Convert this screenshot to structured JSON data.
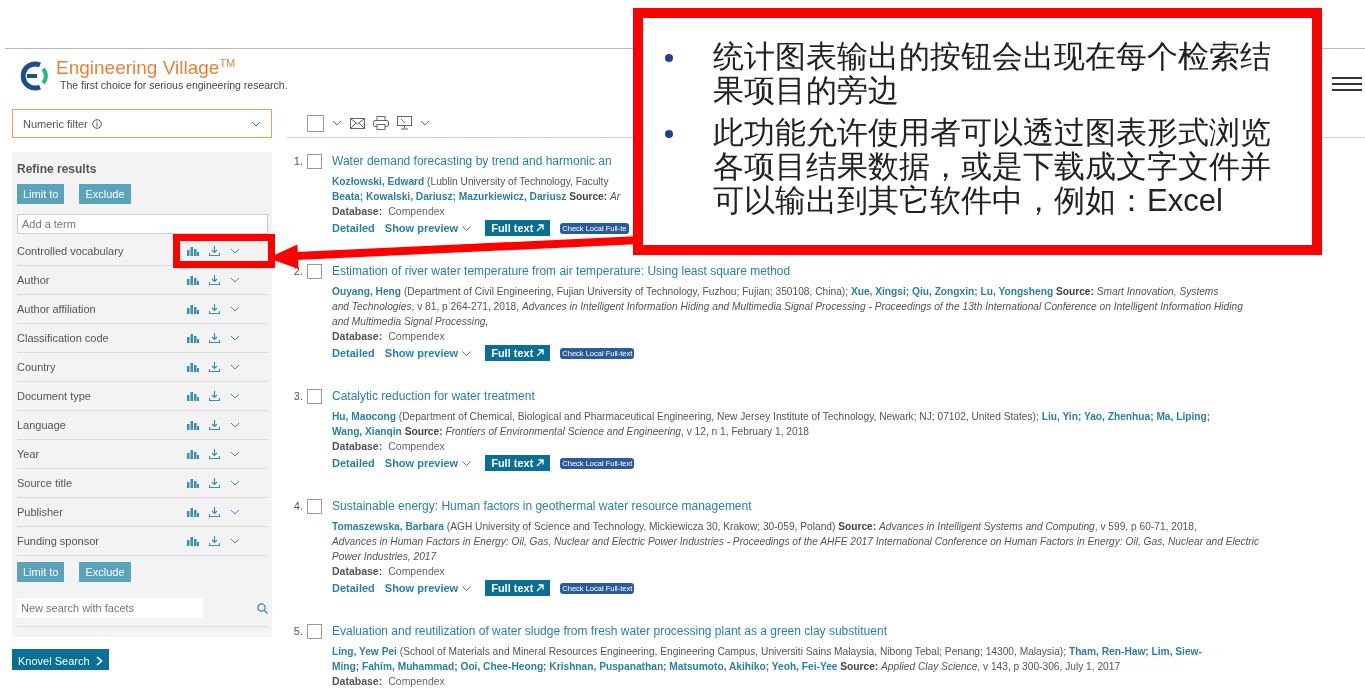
{
  "logo": {
    "name": "Engineering Village",
    "trademark": "TM",
    "tagline": "The first choice for serious engineering research."
  },
  "numeric_filter": {
    "label": "Numeric filter"
  },
  "refine": {
    "title": "Refine results",
    "top_buttons": [
      "Limit to",
      "Exclude"
    ],
    "term_placeholder": "Add a term",
    "facets": [
      {
        "label": "Controlled vocabulary",
        "highlighted": true
      },
      {
        "label": "Author",
        "highlighted": false
      },
      {
        "label": "Author affiliation",
        "highlighted": false
      },
      {
        "label": "Classification code",
        "highlighted": false
      },
      {
        "label": "Country",
        "highlighted": false
      },
      {
        "label": "Document type",
        "highlighted": false
      },
      {
        "label": "Language",
        "highlighted": false
      },
      {
        "label": "Year",
        "highlighted": false
      },
      {
        "label": "Source title",
        "highlighted": false
      },
      {
        "label": "Publisher",
        "highlighted": false
      },
      {
        "label": "Funding sponsor",
        "highlighted": false
      }
    ],
    "bottom_buttons": [
      "Limit to",
      "Exclude"
    ],
    "facet_search_placeholder": "New search with facets"
  },
  "knovel_button": "Knovel Search",
  "select_all": {
    "checked": false
  },
  "results": [
    {
      "number": "1.",
      "checked": false,
      "title": "Water demand forecasting by trend and harmonic an",
      "lines": [
        [
          {
            "kind": "author",
            "t": "Kozłowski, Edward"
          },
          {
            "kind": "plain",
            "t": " (Lublin University of Technology, Faculty"
          }
        ],
        [
          {
            "kind": "author",
            "t": "Beata; Kowalski, Dariusz; Mazurkiewicz, Dariusz"
          },
          {
            "kind": "label",
            "t": " Source: "
          },
          {
            "kind": "italic",
            "t": "Ar"
          }
        ]
      ],
      "database_label": "Database:",
      "database": "Compendex",
      "actions": {
        "detailed": "Detailed",
        "preview": "Show preview",
        "full_text": "Full text",
        "local": "Check Local Full-te"
      }
    },
    {
      "number": "2.",
      "checked": false,
      "title": "Estimation of river water temperature from air temperature: Using least square method",
      "lines": [
        [
          {
            "kind": "author",
            "t": "Ouyang, Heng"
          },
          {
            "kind": "plain",
            "t": " (Department of Civil Engineering, Fujian University of Technology, Fuzhou; Fujian; 350108, China); "
          },
          {
            "kind": "author",
            "t": "Xue, Xingsi; Qiu, Zongxin; Lu, Yongsheng"
          },
          {
            "kind": "label",
            "t": " Source: "
          },
          {
            "kind": "italic",
            "t": "Smart Innovation, Systems"
          }
        ],
        [
          {
            "kind": "italic",
            "t": "and Technologies"
          },
          {
            "kind": "plain",
            "t": ", v 81, p 264-271, 2018, "
          },
          {
            "kind": "italic",
            "t": "Advances in Intelligent Information Hiding and Multimedia Signal Processing - Proceedings of the 13th International Conference on Intelligent Information Hiding"
          }
        ],
        [
          {
            "kind": "italic",
            "t": "and Multimedia Signal Processing,"
          }
        ]
      ],
      "database_label": "Database:",
      "database": "Compendex",
      "actions": {
        "detailed": "Detailed",
        "preview": "Show preview",
        "full_text": "Full text",
        "local": "Check Local Full-text"
      }
    },
    {
      "number": "3.",
      "checked": false,
      "title": "Catalytic reduction for water treatment",
      "lines": [
        [
          {
            "kind": "author",
            "t": "Hu, Maocong"
          },
          {
            "kind": "plain",
            "t": " (Department of Chemical, Biological and Pharmaceutical Engineering, New Jersey Institute of Technology, Newark; NJ; 07102, United States); "
          },
          {
            "kind": "author",
            "t": "Liu, Yin; Yao, Zhenhua; Ma, Liping;"
          }
        ],
        [
          {
            "kind": "author",
            "t": "Wang, Xianqin"
          },
          {
            "kind": "label",
            "t": " Source: "
          },
          {
            "kind": "italic",
            "t": "Frontiers of Environmental Science and Engineering"
          },
          {
            "kind": "plain",
            "t": ", v 12, n 1, February 1, 2018"
          }
        ]
      ],
      "database_label": "Database:",
      "database": "Compendex",
      "actions": {
        "detailed": "Detailed",
        "preview": "Show preview",
        "full_text": "Full text",
        "local": "Check Local Full-text"
      }
    },
    {
      "number": "4.",
      "checked": false,
      "title": "Sustainable energy: Human factors in geothermal water resource management",
      "lines": [
        [
          {
            "kind": "author",
            "t": "Tomaszewska, Barbara"
          },
          {
            "kind": "plain",
            "t": " (AGH University of Science and Technology, Mickiewicza 30, Krakow; 30-059, Poland) "
          },
          {
            "kind": "label",
            "t": "Source: "
          },
          {
            "kind": "italic",
            "t": "Advances in Intelligent Systems and Computing"
          },
          {
            "kind": "plain",
            "t": ", v 599, p 60-71, 2018,"
          }
        ],
        [
          {
            "kind": "italic",
            "t": "Advances in Human Factors in Energy: Oil, Gas, Nuclear and Electric Power Industries - Proceedings of the AHFE 2017 International Conference on Human Factors in Energy: Oil, Gas, Nuclear and Electric"
          }
        ],
        [
          {
            "kind": "italic",
            "t": "Power Industries, 2017"
          }
        ]
      ],
      "database_label": "Database:",
      "database": "Compendex",
      "actions": {
        "detailed": "Detailed",
        "preview": "Show preview",
        "full_text": "Full text",
        "local": "Check Local Full-text"
      }
    },
    {
      "number": "5.",
      "checked": false,
      "title": "Evaluation and reutilization of water sludge from fresh water processing plant as a green clay substituent",
      "lines": [
        [
          {
            "kind": "author",
            "t": "Ling, Yew Pei"
          },
          {
            "kind": "plain",
            "t": " (School of Materials and Mineral Resources Engineering, Engineering Campus, Universiti Sains Malaysia, Nibong Tebal; Penang; 14300, Malaysia); "
          },
          {
            "kind": "author",
            "t": "Tham, Ren-Haw; Lim, Siew-"
          }
        ],
        [
          {
            "kind": "author",
            "t": "Ming; Fahim, Muhammad; Ooi, Chee-Heong; Krishnan, Puspanathan; Matsumoto, Akihiko; Yeoh, Fei-Yee"
          },
          {
            "kind": "label",
            "t": " Source: "
          },
          {
            "kind": "italic",
            "t": "Applied Clay Science"
          },
          {
            "kind": "plain",
            "t": ", v 143, p 300-306, July 1, 2017"
          }
        ]
      ],
      "database_label": "Database:",
      "database": "Compendex"
    }
  ],
  "callout": {
    "bullets": [
      "统计图表输出的按钮会出现在每个检索结果项目的旁边",
      "此功能允许使用者可以透过图表形式浏览各项目结果数据，或是下载成文字文件并可以输出到其它软件中，例如：Excel"
    ]
  }
}
